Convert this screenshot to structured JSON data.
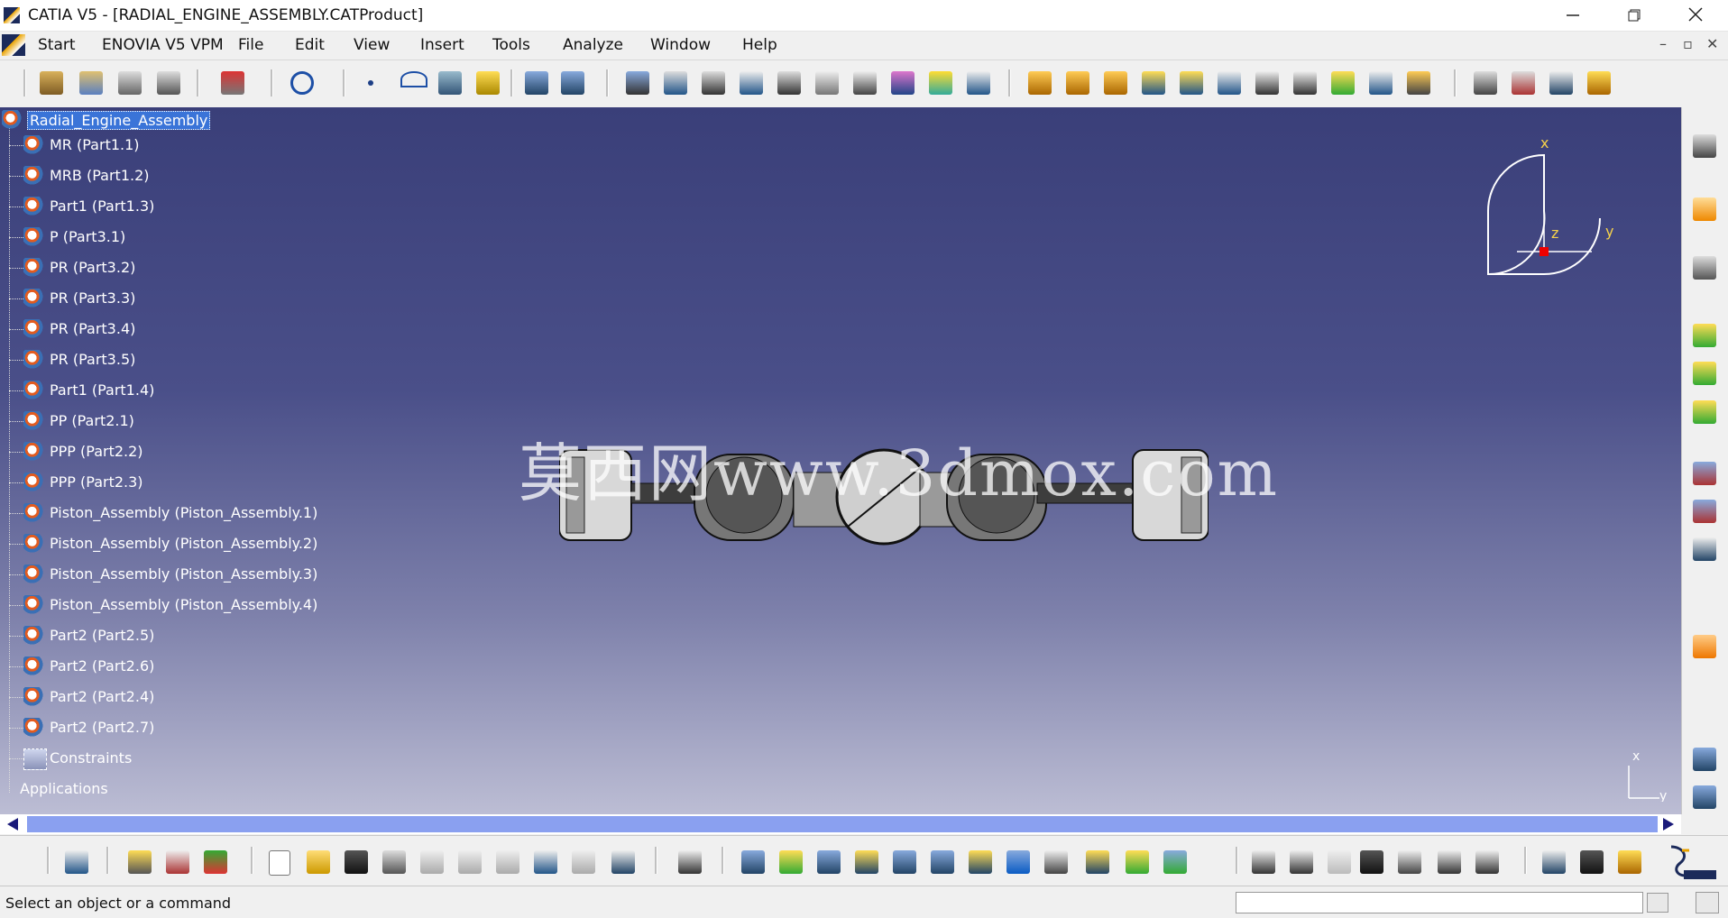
{
  "window": {
    "title": "CATIA V5 - [RADIAL_ENGINE_ASSEMBLY.CATProduct]",
    "minimize_icon": "minimize-icon",
    "restore_icon": "restore-icon",
    "close_icon": "close-icon"
  },
  "menubar": {
    "items": [
      "Start",
      "ENOVIA V5 VPM",
      "File",
      "Edit",
      "View",
      "Insert",
      "Tools",
      "Analyze",
      "Window",
      "Help"
    ]
  },
  "tree": {
    "root": "Radial_Engine_Assembly",
    "items": [
      "MR (Part1.1)",
      "MRB (Part1.2)",
      "Part1 (Part1.3)",
      "P (Part3.1)",
      "PR (Part3.2)",
      "PR (Part3.3)",
      "PR (Part3.4)",
      "PR (Part3.5)",
      "Part1 (Part1.4)",
      "PP (Part2.1)",
      "PPP (Part2.2)",
      "PPP (Part2.3)",
      "Piston_Assembly (Piston_Assembly.1)",
      "Piston_Assembly (Piston_Assembly.2)",
      "Piston_Assembly (Piston_Assembly.3)",
      "Piston_Assembly (Piston_Assembly.4)",
      "Part2 (Part2.5)",
      "Part2 (Part2.6)",
      "Part2 (Part2.4)",
      "Part2 (Part2.7)",
      "Constraints",
      "Applications"
    ]
  },
  "compass": {
    "x": "x",
    "y": "y",
    "z": "z"
  },
  "axis_indicator": {
    "x": "x",
    "y": "y"
  },
  "watermark": "莫西网www.3dmox.com",
  "status": {
    "message": "Select an object or a command"
  },
  "colors": {
    "viewport_top": "#3a3f79",
    "viewport_bottom": "#bcbdd4",
    "tree_selected": "#3a74d8",
    "scroll_track": "#8aa0f0",
    "accent_orange": "#e9a200"
  }
}
